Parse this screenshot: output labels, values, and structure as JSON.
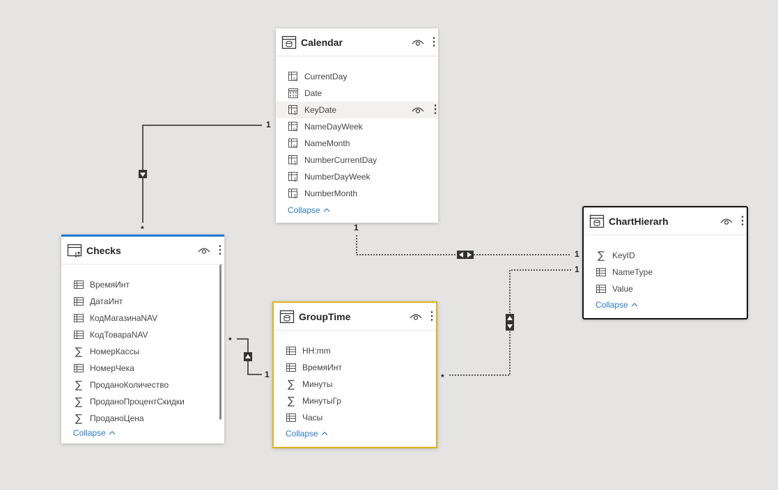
{
  "tables": {
    "calendar": {
      "title": "Calendar",
      "fields": [
        {
          "name": "CurrentDay",
          "icon": "calc-column-icon"
        },
        {
          "name": "Date",
          "icon": "date-column-icon"
        },
        {
          "name": "KeyDate",
          "icon": "numeric-column-icon"
        },
        {
          "name": "NameDayWeek",
          "icon": "calc-column-icon"
        },
        {
          "name": "NameMonth",
          "icon": "calc-column-icon"
        },
        {
          "name": "NumberCurrentDay",
          "icon": "numeric-column-icon"
        },
        {
          "name": "NumberDayWeek",
          "icon": "numeric-column-icon"
        },
        {
          "name": "NumberMonth",
          "icon": "numeric-column-icon"
        }
      ],
      "collapse_label": "Collapse"
    },
    "checks": {
      "title": "Checks",
      "fields": [
        {
          "name": "ВремяИнт",
          "icon": "table-column-icon"
        },
        {
          "name": "ДатаИнт",
          "icon": "table-column-icon"
        },
        {
          "name": "КодМагазинаNAV",
          "icon": "table-column-icon"
        },
        {
          "name": "КодТовараNAV",
          "icon": "table-column-icon"
        },
        {
          "name": "НомерКассы",
          "icon": "sigma-icon"
        },
        {
          "name": "НомерЧека",
          "icon": "table-column-icon"
        },
        {
          "name": "ПроданоКоличество",
          "icon": "sigma-icon"
        },
        {
          "name": "ПроданоПроцентСкидки",
          "icon": "sigma-icon"
        },
        {
          "name": "ПроданоЦена",
          "icon": "sigma-icon"
        }
      ],
      "collapse_label": "Collapse"
    },
    "grouptime": {
      "title": "GroupTime",
      "fields": [
        {
          "name": "HH:mm",
          "icon": "table-column-icon"
        },
        {
          "name": "ВремяИнт",
          "icon": "table-column-icon"
        },
        {
          "name": "Минуты",
          "icon": "sigma-icon"
        },
        {
          "name": "МинутыГр",
          "icon": "sigma-icon"
        },
        {
          "name": "Часы",
          "icon": "table-column-icon"
        }
      ],
      "collapse_label": "Collapse"
    },
    "charthierarh": {
      "title": "ChartHierarh",
      "fields": [
        {
          "name": "KeyID",
          "icon": "sigma-icon"
        },
        {
          "name": "NameType",
          "icon": "table-column-icon"
        },
        {
          "name": "Value",
          "icon": "table-column-icon"
        }
      ],
      "collapse_label": "Collapse"
    }
  },
  "cardinality": {
    "one": "1",
    "many": "*"
  },
  "colors": {
    "canvas_bg": "#e5e4e2",
    "checks_accent": "#1f7ad1",
    "grouptime_border": "#e0b418",
    "charthierarh_border": "#111111",
    "link": "#2b79c2",
    "relationship_line": "#555555"
  }
}
